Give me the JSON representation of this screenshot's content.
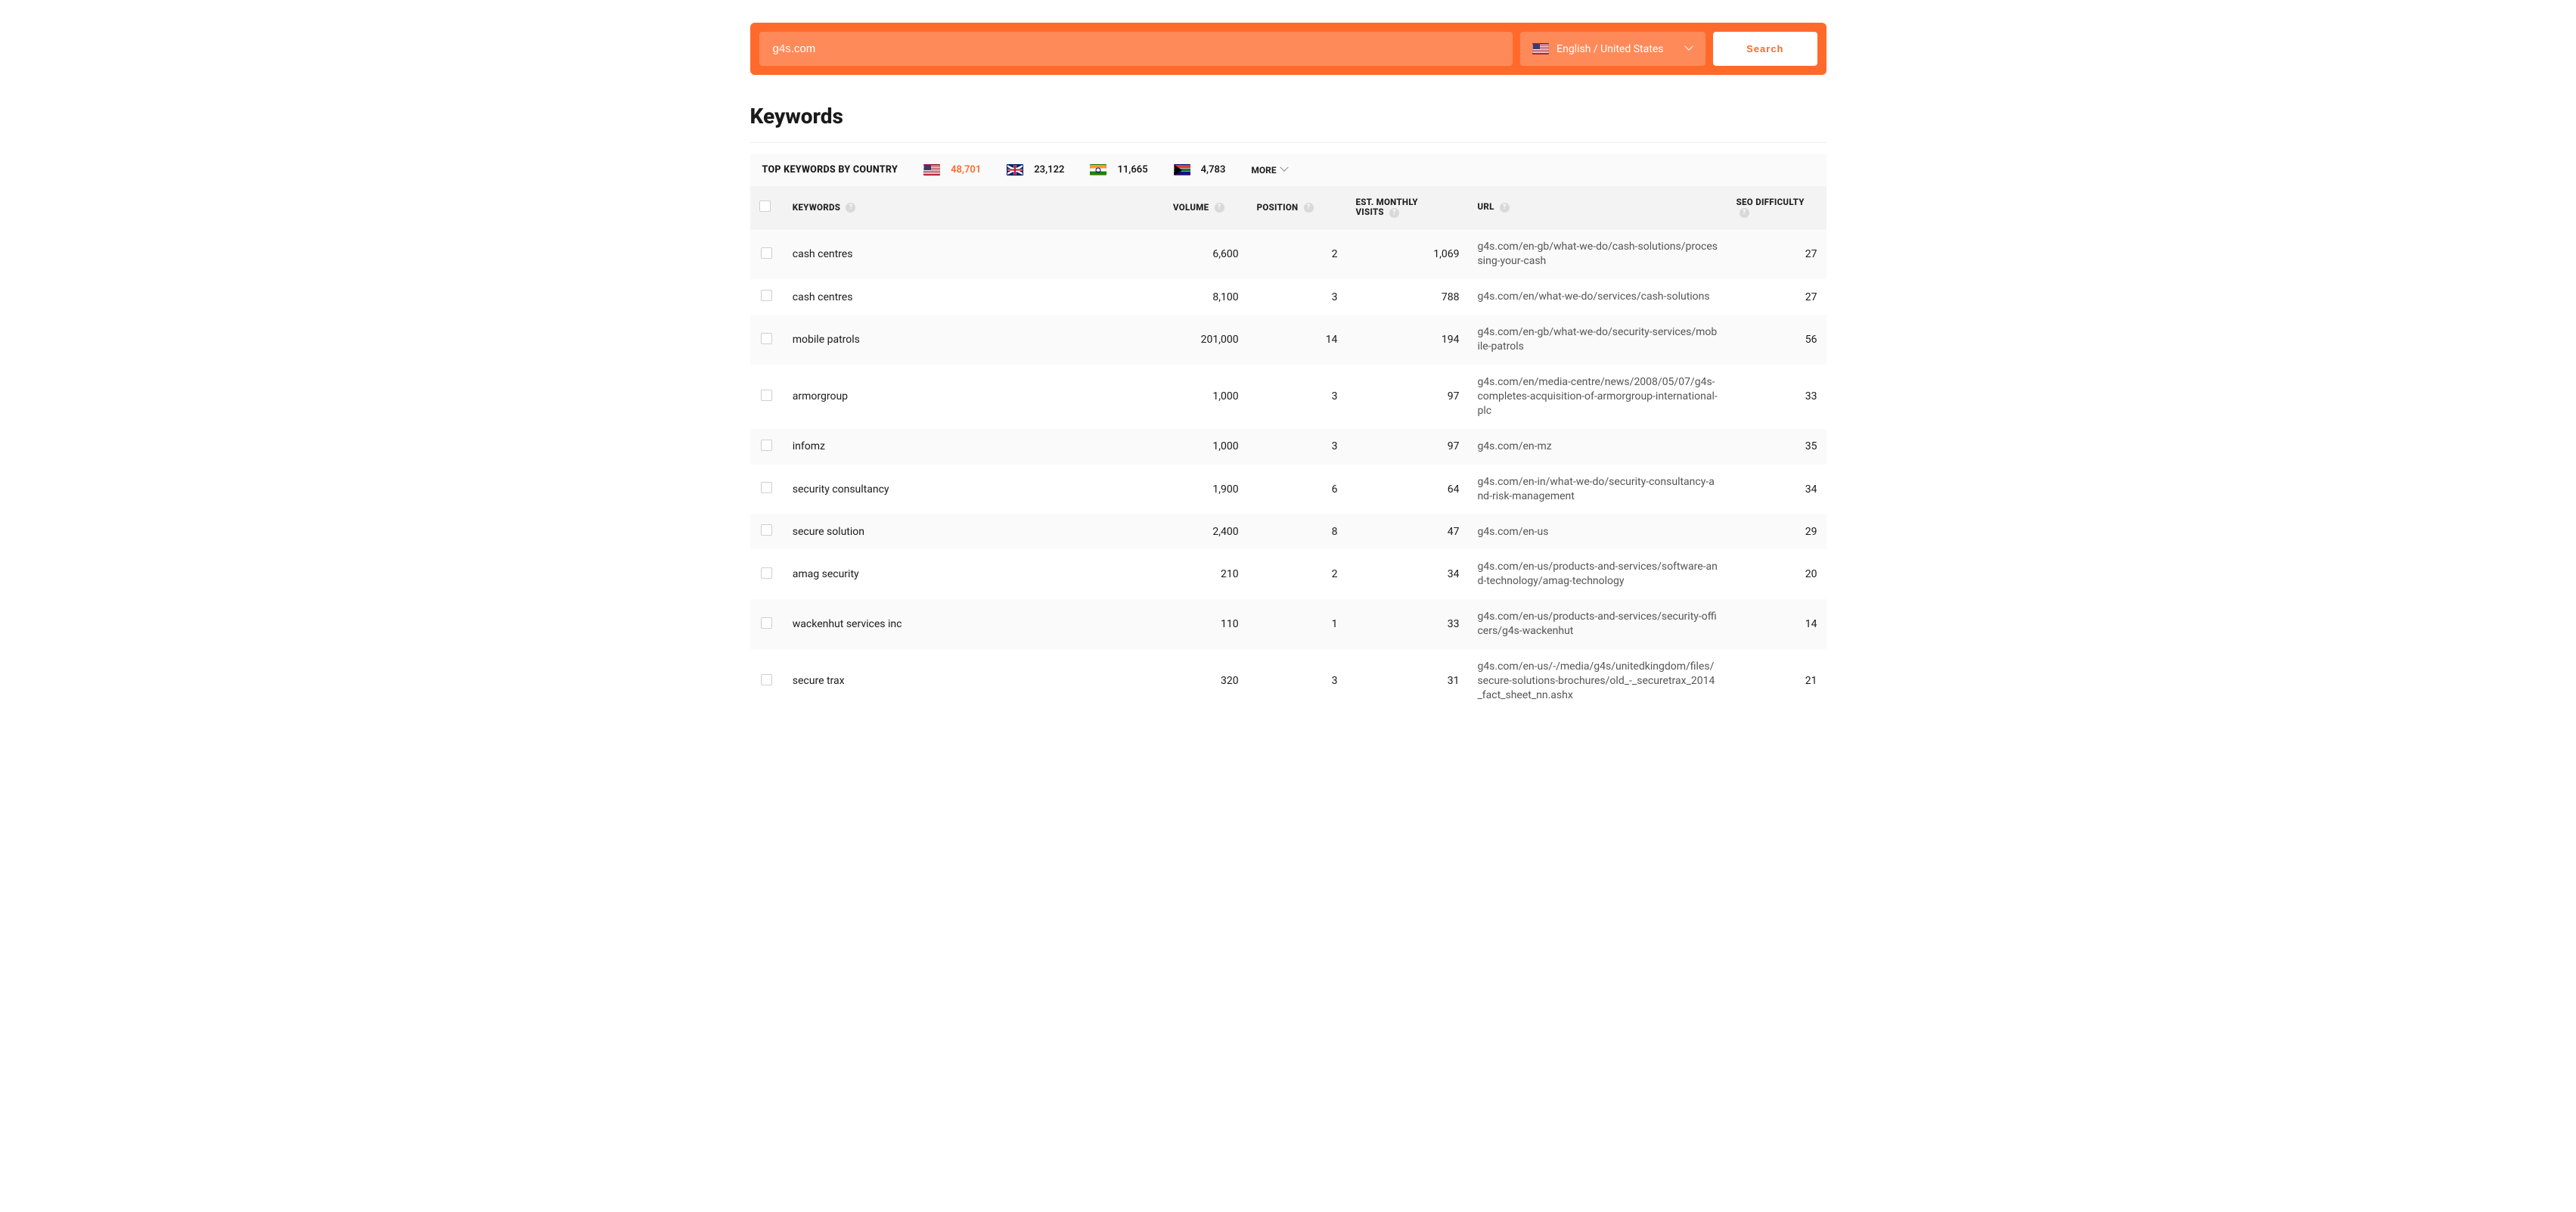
{
  "search": {
    "value": "g4s.com",
    "lang_label": "English / United States",
    "button": "Search"
  },
  "section_title": "Keywords",
  "country_bar": {
    "label": "TOP KEYWORDS BY COUNTRY",
    "more": "MORE",
    "items": [
      {
        "flag": "us",
        "count": "48,701",
        "active": true
      },
      {
        "flag": "gb",
        "count": "23,122",
        "active": false
      },
      {
        "flag": "in",
        "count": "11,665",
        "active": false
      },
      {
        "flag": "za",
        "count": "4,783",
        "active": false
      }
    ]
  },
  "columns": {
    "keywords": "KEYWORDS",
    "volume": "VOLUME",
    "position": "POSITION",
    "visits_l1": "EST. MONTHLY",
    "visits_l2": "VISITS",
    "url": "URL",
    "difficulty": "SEO DIFFICULTY"
  },
  "rows": [
    {
      "keyword": "cash centres",
      "volume": "6,600",
      "position": "2",
      "visits": "1,069",
      "url": "g4s.com/en-gb/what-we-do/cash-solutions/processing-your-cash",
      "difficulty": "27"
    },
    {
      "keyword": "cash centres",
      "volume": "8,100",
      "position": "3",
      "visits": "788",
      "url": "g4s.com/en/what-we-do/services/cash-solutions",
      "difficulty": "27"
    },
    {
      "keyword": "mobile patrols",
      "volume": "201,000",
      "position": "14",
      "visits": "194",
      "url": "g4s.com/en-gb/what-we-do/security-services/mobile-patrols",
      "difficulty": "56"
    },
    {
      "keyword": "armorgroup",
      "volume": "1,000",
      "position": "3",
      "visits": "97",
      "url": "g4s.com/en/media-centre/news/2008/05/07/g4s-completes-acquisition-of-armorgroup-international-plc",
      "difficulty": "33"
    },
    {
      "keyword": "infomz",
      "volume": "1,000",
      "position": "3",
      "visits": "97",
      "url": "g4s.com/en-mz",
      "difficulty": "35"
    },
    {
      "keyword": "security consultancy",
      "volume": "1,900",
      "position": "6",
      "visits": "64",
      "url": "g4s.com/en-in/what-we-do/security-consultancy-and-risk-management",
      "difficulty": "34"
    },
    {
      "keyword": "secure solution",
      "volume": "2,400",
      "position": "8",
      "visits": "47",
      "url": "g4s.com/en-us",
      "difficulty": "29"
    },
    {
      "keyword": "amag security",
      "volume": "210",
      "position": "2",
      "visits": "34",
      "url": "g4s.com/en-us/products-and-services/software-and-technology/amag-technology",
      "difficulty": "20"
    },
    {
      "keyword": "wackenhut services inc",
      "volume": "110",
      "position": "1",
      "visits": "33",
      "url": "g4s.com/en-us/products-and-services/security-officers/g4s-wackenhut",
      "difficulty": "14"
    },
    {
      "keyword": "secure trax",
      "volume": "320",
      "position": "3",
      "visits": "31",
      "url": "g4s.com/en-us/-/media/g4s/unitedkingdom/files/secure-solutions-brochures/old_-_securetrax_2014_fact_sheet_nn.ashx",
      "difficulty": "21"
    }
  ]
}
